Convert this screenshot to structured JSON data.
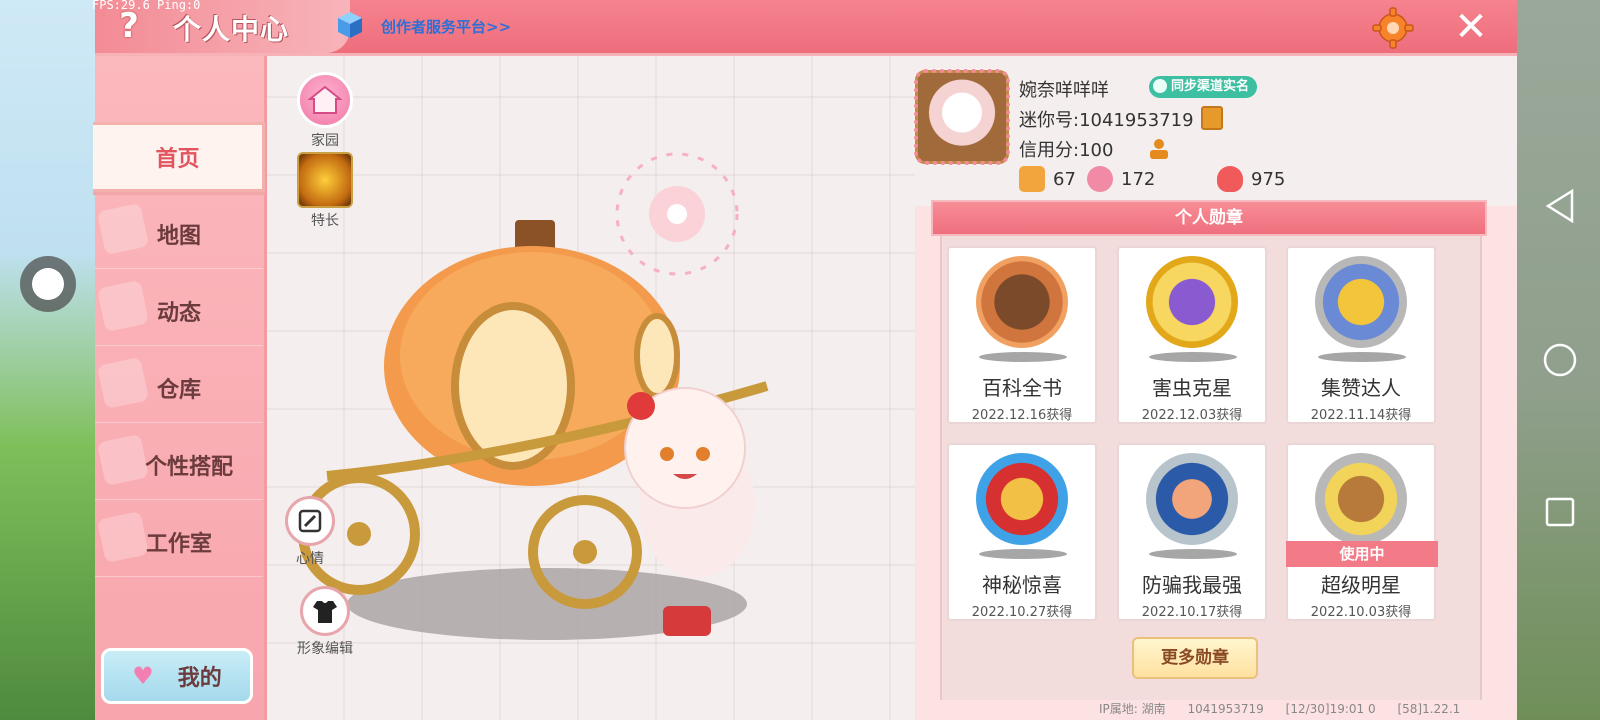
{
  "overlay": {
    "fps_text": "FPS:29.6  Ping:0"
  },
  "header": {
    "title": "个人中心",
    "creator_link": "创作者服务平台>>",
    "close_glyph": "✕",
    "help_glyph": "?"
  },
  "sidebar": {
    "items": [
      {
        "label": "首页",
        "active": true
      },
      {
        "label": "地图"
      },
      {
        "label": "动态"
      },
      {
        "label": "仓库"
      },
      {
        "label": "个性搭配"
      },
      {
        "label": "工作室"
      }
    ],
    "my_button": "我的"
  },
  "quick_actions": {
    "home": "家园",
    "skill": "特长",
    "mood": "心情",
    "avatar_edit": "形象编辑"
  },
  "profile": {
    "nickname": "婉奈咩咩咩",
    "realname_badge": "同步渠道实名",
    "mini_id": "迷你号:1041953719",
    "credit": "信用分:100",
    "stats": [
      {
        "icon": "badge-plus-icon",
        "value": "67"
      },
      {
        "icon": "likes-icon",
        "value": "172"
      },
      {
        "icon": "fire-icon",
        "value": "975"
      }
    ]
  },
  "medals": {
    "header": "个人勋章",
    "items": [
      {
        "name": "百科全书",
        "date": "2022.12.16获得",
        "color": "#c25a2a"
      },
      {
        "name": "害虫克星",
        "date": "2022.12.03获得",
        "color": "#e4b21f"
      },
      {
        "name": "集赞达人",
        "date": "2022.11.14获得",
        "color": "#9a9a9a"
      },
      {
        "name": "神秘惊喜",
        "date": "2022.10.27获得",
        "color": "#2b86d6"
      },
      {
        "name": "防骗我最强",
        "date": "2022.10.17获得",
        "color": "#8a9aa8"
      },
      {
        "name": "超级明星",
        "date": "2022.10.03获得",
        "color": "#a8a8a8",
        "in_use": "使用中"
      }
    ],
    "more_button": "更多勋章"
  },
  "footer": {
    "ip_location": "IP属地: 湖南",
    "account": "1041953719",
    "time_info": "[12/30]19:01 0",
    "version": "[58]1.22.1"
  }
}
